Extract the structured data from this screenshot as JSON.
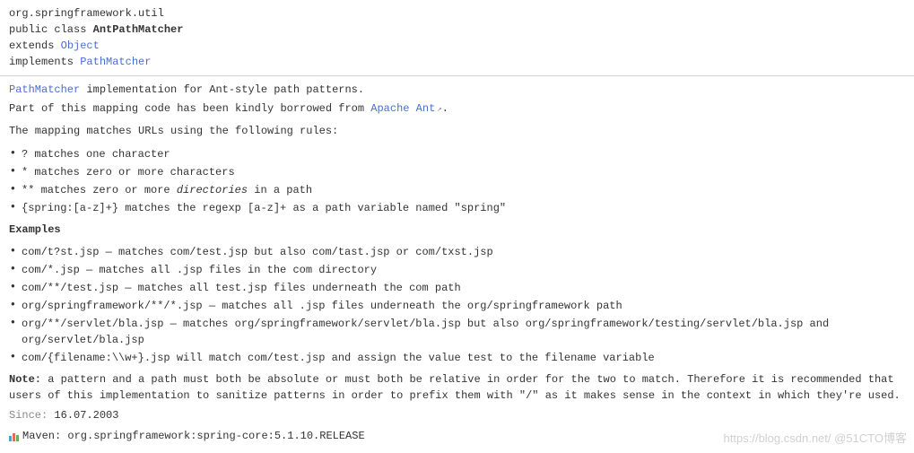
{
  "header": {
    "package": "org.springframework.util",
    "modifier": "public class",
    "className": "AntPathMatcher",
    "extendsLabel": "extends",
    "extendsTarget": "Object",
    "implementsLabel": "implements",
    "implementsTarget": "PathMatcher"
  },
  "intro": {
    "link1": "PathMatcher",
    "text1": " implementation for Ant-style path patterns.",
    "text2": "Part of this mapping code has been kindly borrowed from ",
    "link2": "Apache Ant",
    "period": "."
  },
  "mappingIntro": "The mapping matches URLs using the following rules:",
  "rules": [
    {
      "code": "?",
      "desc": " matches one character"
    },
    {
      "code": "*",
      "desc": " matches zero or more characters"
    },
    {
      "code": "**",
      "desc": " matches zero or more ",
      "italic": "directories",
      "tail": " in a path"
    },
    {
      "code": "{spring:[a-z]+}",
      "desc": " matches the regexp [a-z]+ as a path variable named \"spring\""
    }
  ],
  "examplesHeading": "Examples",
  "examples": [
    "com/t?st.jsp — matches com/test.jsp but also com/tast.jsp or com/txst.jsp",
    "com/*.jsp — matches all .jsp files in the com directory",
    "com/**/test.jsp — matches all test.jsp files underneath the com path",
    "org/springframework/**/*.jsp — matches all .jsp files underneath the org/springframework path",
    "org/**/servlet/bla.jsp — matches org/springframework/servlet/bla.jsp but also org/springframework/testing/servlet/bla.jsp and org/servlet/bla.jsp",
    "com/{filename:\\\\w+}.jsp will match com/test.jsp and assign the value test to the filename variable"
  ],
  "noteLabel": "Note:",
  "noteText": " a pattern and a path must both be absolute or must both be relative in order for the two to match. Therefore it is recommended that users of this implementation to sanitize patterns in order to prefix them with \"/\" as it makes sense in the context in which they're used.",
  "sinceLabel": "Since:",
  "sinceValue": "16.07.2003",
  "mavenText": "Maven: org.springframework:spring-core:5.1.10.RELEASE",
  "watermark": "https://blog.csdn.net/ @51CTO博客"
}
